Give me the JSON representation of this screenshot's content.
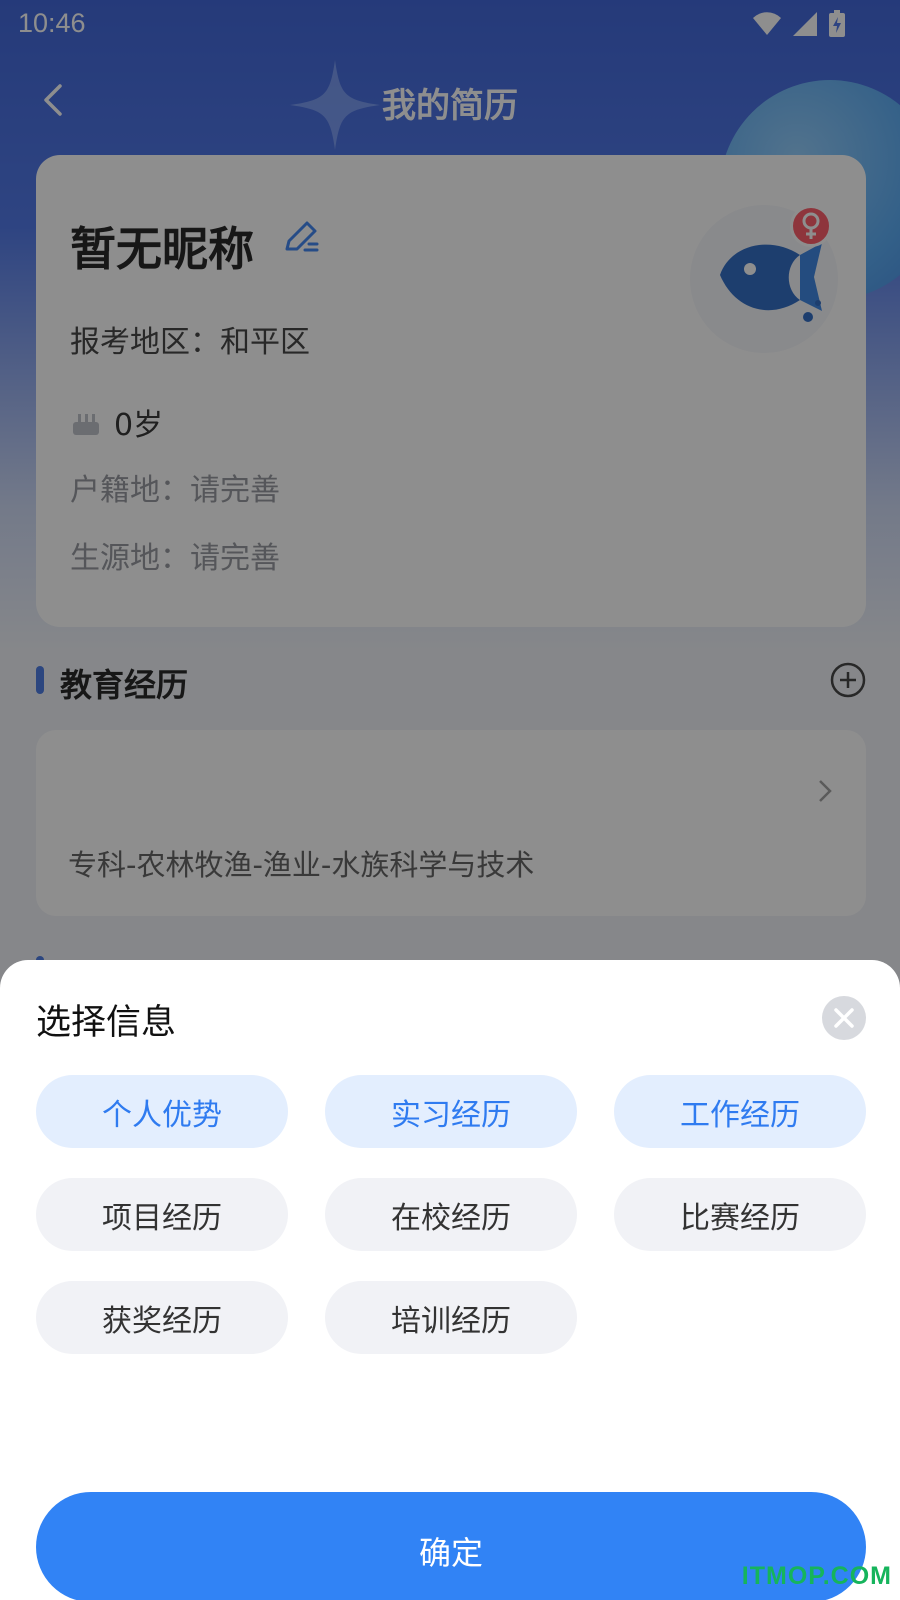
{
  "status_bar": {
    "time": "10:46"
  },
  "nav": {
    "title": "我的简历"
  },
  "profile": {
    "nickname": "暂无昵称",
    "region": "报考地区：和平区",
    "age": "0岁",
    "household": "户籍地：请完善",
    "origin": "生源地：请完善"
  },
  "education": {
    "title": "教育经历",
    "entry": "专科-农林牧渔-渔业-水族科学与技术"
  },
  "sheet": {
    "title": "选择信息",
    "options": [
      {
        "label": "个人优势",
        "selected": true
      },
      {
        "label": "实习经历",
        "selected": true
      },
      {
        "label": "工作经历",
        "selected": true
      },
      {
        "label": "项目经历",
        "selected": false
      },
      {
        "label": "在校经历",
        "selected": false
      },
      {
        "label": "比赛经历",
        "selected": false
      },
      {
        "label": "获奖经历",
        "selected": false
      },
      {
        "label": "培训经历",
        "selected": false
      }
    ],
    "confirm_label": "确定"
  },
  "colors": {
    "primary": "#3183f5",
    "selected_chip_bg": "#e3eefe",
    "gender_badge": "#ff4d5a"
  },
  "watermark": "ITMOP.COM"
}
